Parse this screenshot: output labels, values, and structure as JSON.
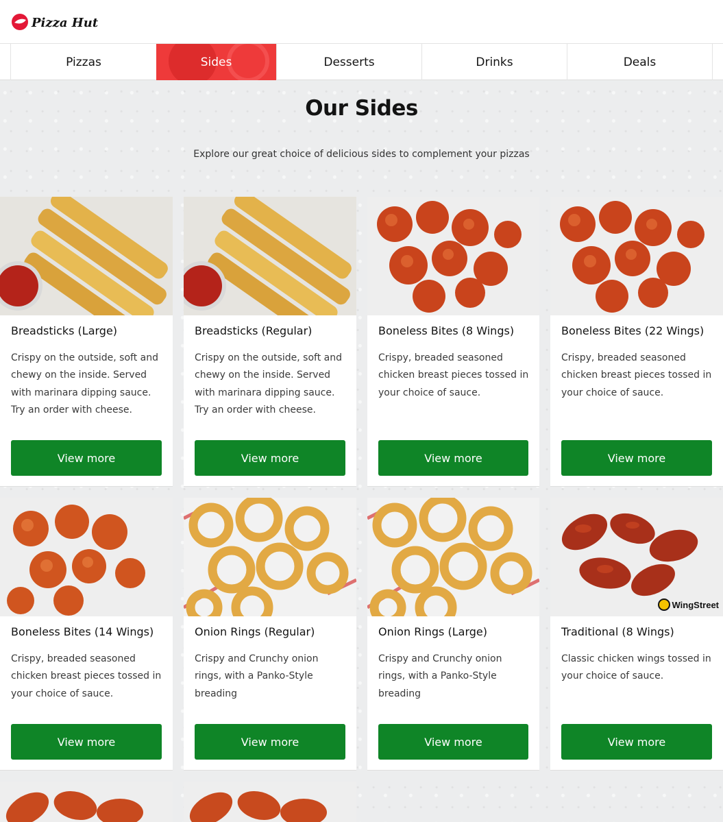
{
  "brand": {
    "name": "Pizza Hut",
    "accent": "#ee3a3a",
    "button_color": "#0f8527"
  },
  "nav": {
    "tabs": [
      {
        "label": "Pizzas",
        "active": false
      },
      {
        "label": "Sides",
        "active": true
      },
      {
        "label": "Desserts",
        "active": false
      },
      {
        "label": "Drinks",
        "active": false
      },
      {
        "label": "Deals",
        "active": false
      }
    ]
  },
  "main": {
    "title": "Our Sides",
    "subtitle": "Explore our great choice of delicious sides to complement your pizzas"
  },
  "products": [
    {
      "name": "Breadsticks (Large)",
      "description": "Crispy on the outside, soft and chewy on the inside. Served with marinara dipping sauce. Try an order with cheese.",
      "button": "View more",
      "image": "breadsticks-image"
    },
    {
      "name": "Breadsticks (Regular)",
      "description": "Crispy on the outside, soft and chewy on the inside. Served with marinara dipping sauce. Try an order with cheese.",
      "button": "View more",
      "image": "breadsticks-image"
    },
    {
      "name": "Boneless Bites (8 Wings)",
      "description": "Crispy, breaded seasoned chicken breast pieces tossed in your choice of sauce.",
      "button": "View more",
      "image": "boneless-bites-image"
    },
    {
      "name": "Boneless Bites (22 Wings)",
      "description": "Crispy, breaded seasoned chicken breast pieces tossed in your choice of sauce.",
      "button": "View more",
      "image": "boneless-bites-image"
    },
    {
      "name": "Boneless Bites (14 Wings)",
      "description": "Crispy, breaded seasoned chicken breast pieces tossed in your choice of sauce.",
      "button": "View more",
      "image": "boneless-bites-image"
    },
    {
      "name": "Onion Rings (Regular)",
      "description": "Crispy and Crunchy onion rings, with a Panko-Style breading",
      "button": "View more",
      "image": "onion-rings-image"
    },
    {
      "name": "Onion Rings (Large)",
      "description": "Crispy and Crunchy onion rings, with a Panko-Style breading",
      "button": "View more",
      "image": "onion-rings-image"
    },
    {
      "name": "Traditional (8 Wings)",
      "description": "Classic chicken wings tossed in your choice of sauce.",
      "button": "View more",
      "image": "chicken-wings-image",
      "badge": "WingStreet"
    }
  ]
}
